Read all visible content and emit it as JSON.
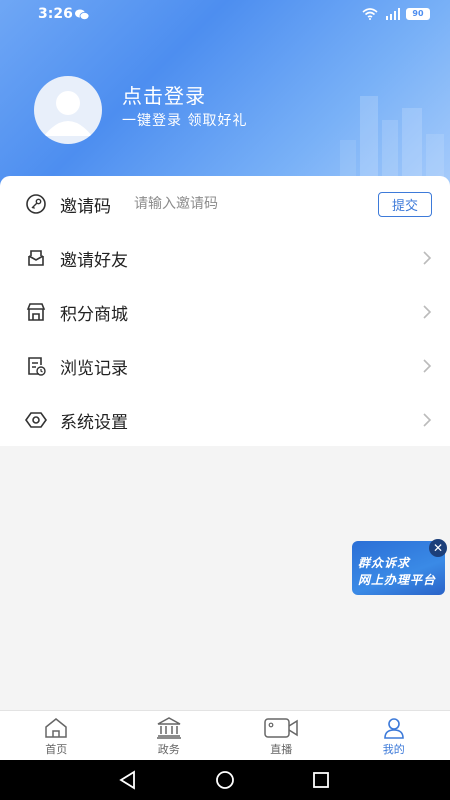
{
  "status": {
    "time": "3:26",
    "battery": "90"
  },
  "profile": {
    "login_title": "点击登录",
    "login_subtitle": "一键登录  领取好礼"
  },
  "invite": {
    "label": "邀请码",
    "placeholder": "请输入邀请码",
    "submit_label": "提交"
  },
  "menu": {
    "items": [
      {
        "label": "邀请好友",
        "icon": "envelope-icon"
      },
      {
        "label": "积分商城",
        "icon": "store-icon"
      },
      {
        "label": "浏览记录",
        "icon": "history-icon"
      },
      {
        "label": "系统设置",
        "icon": "settings-icon"
      }
    ]
  },
  "float_banner": {
    "line1": "群众诉求",
    "line2": "网上办理平台",
    "close_glyph": "✕"
  },
  "tabbar": {
    "tabs": [
      {
        "label": "首页",
        "icon": "home-icon",
        "active": false
      },
      {
        "label": "政务",
        "icon": "government-icon",
        "active": false
      },
      {
        "label": "直播",
        "icon": "video-icon",
        "active": false
      },
      {
        "label": "我的",
        "icon": "user-icon",
        "active": true
      }
    ]
  },
  "colors": {
    "accent": "#3d7ad9",
    "header_start": "#6fa7f5",
    "header_end": "#a9cdfb"
  }
}
